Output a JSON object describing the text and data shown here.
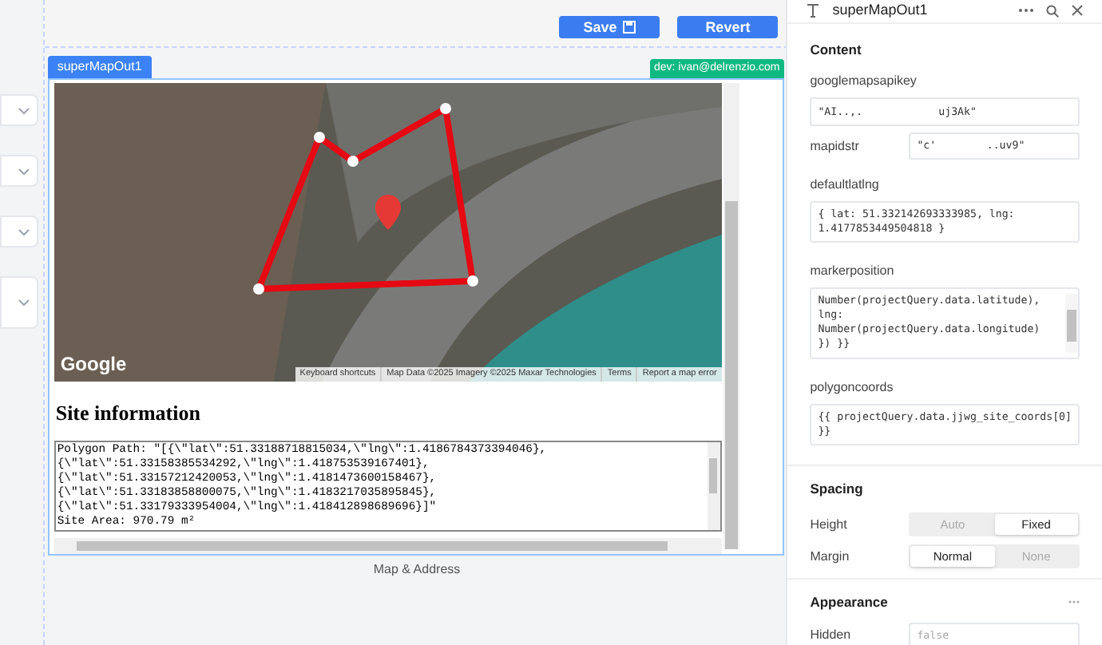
{
  "toolbar": {
    "buttons": [
      {
        "label": "Save",
        "kind": "save"
      },
      {
        "label": "Revert",
        "kind": "plain"
      }
    ]
  },
  "left_dropdowns": [
    {
      "kind": "short"
    },
    {
      "kind": "short"
    },
    {
      "kind": "short"
    },
    {
      "kind": "tall"
    }
  ],
  "component": {
    "name_tag": "superMapOut1",
    "user_tag": "dev: ivan@delrenzio.com",
    "map": {
      "logo": "Google",
      "attribution": [
        "Keyboard shortcuts",
        "Map Data ©2025 Imagery ©2025 Maxar Technologies",
        "Terms",
        "Report a map error"
      ]
    },
    "heading": "Site information",
    "output_lines": [
      "Polygon Path: \"[{\\\"lat\\\":51.33188718815034,\\\"lng\\\":1.4186784373394046},",
      "{\\\"lat\\\":51.33158385534292,\\\"lng\\\":1.418753539167401},",
      "{\\\"lat\\\":51.33157212420053,\\\"lng\\\":1.4181473600158467},",
      "{\\\"lat\\\":51.33183858800075,\\\"lng\\\":1.4183217035895845},",
      "{\\\"lat\\\":51.33179333954004,\\\"lng\\\":1.418412898689696}]\"",
      "Site Area: 970.79 m²"
    ]
  },
  "section_label": "Map & Address",
  "inspector": {
    "title": "superMapOut1",
    "content_heading": "Content",
    "fields": [
      {
        "label": "googlemapsapikey",
        "kind": "wide",
        "value": "\"AI..,.            uj3Ak\""
      },
      {
        "label": "mapidstr",
        "kind": "inline",
        "value": "\"c'        ..uv9\""
      },
      {
        "label": "defaultlatlng",
        "kind": "code",
        "lines": [
          "{ lat: 51.332142693333985, lng:",
          "1.4177853449504818 }"
        ]
      },
      {
        "label": "markerposition",
        "kind": "scrollcode",
        "lines": [
          "Number(projectQuery.data.latitude),",
          "lng:",
          "Number(projectQuery.data.longitude)",
          "}) }}"
        ]
      },
      {
        "label": "polygoncoords",
        "kind": "code",
        "lines": [
          "{{ projectQuery.data.jjwg_site_coords[0]",
          "}}"
        ]
      }
    ],
    "spacing_heading": "Spacing",
    "segments": [
      {
        "label": "Height",
        "options": [
          {
            "label": "Auto",
            "selected": false
          },
          {
            "label": "Fixed",
            "selected": true
          }
        ]
      },
      {
        "label": "Margin",
        "options": [
          {
            "label": "Normal",
            "selected": true
          },
          {
            "label": "None",
            "selected": false
          }
        ]
      }
    ],
    "appearance_heading": "Appearance",
    "hidden": {
      "label": "Hidden",
      "placeholder": "false"
    }
  }
}
